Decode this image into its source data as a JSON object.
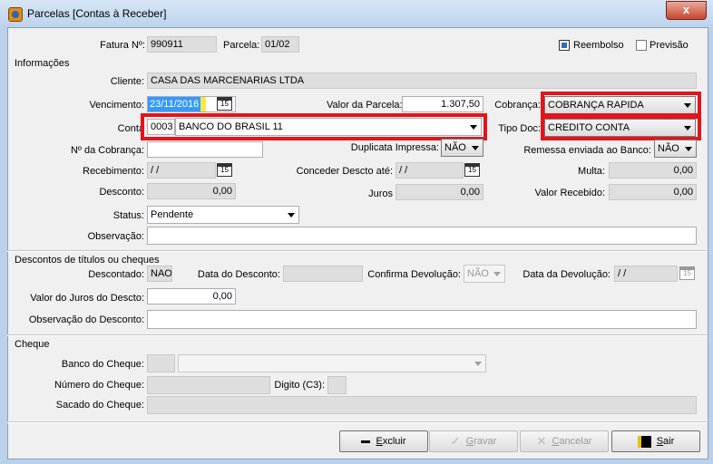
{
  "window": {
    "title": "Parcelas  [Contas à Receber]",
    "close_glyph": "x"
  },
  "header": {
    "fatura_label": "Fatura Nº:",
    "fatura_value": "990911",
    "parcela_label": "Parcela:",
    "parcela_value": "01/02",
    "reembolso_label": "Reembolso",
    "reembolso_checked": true,
    "previsao_label": "Previsão",
    "previsao_checked": false
  },
  "informacoes": {
    "section_label": "Informações",
    "cliente_label": "Cliente:",
    "cliente_value": "CASA DAS MARCENARIAS LTDA",
    "vencimento_label": "Vencimento:",
    "vencimento_value": "23/11/2016",
    "valor_parcela_label": "Valor da Parcela:",
    "valor_parcela_value": "1.307,50",
    "cobranca_label": "Cobrança:",
    "cobranca_value": "COBRANÇA RAPIDA",
    "conta_label": "Conta",
    "conta_code": "0003",
    "conta_value": "BANCO DO BRASIL 11",
    "tipo_doc_label": "Tipo Doc:",
    "tipo_doc_value": "CREDITO CONTA",
    "num_cobranca_label": "Nº da Cobrança:",
    "num_cobranca_value": "",
    "duplicata_label": "Duplicata Impressa:",
    "duplicata_value": "NÃO",
    "remessa_label": "Remessa enviada ao Banco:",
    "remessa_value": "NÃO",
    "recebimento_label": "Recebimento:",
    "recebimento_value": " / /",
    "conceder_label": "Conceder Descto até:",
    "conceder_value": " / /",
    "multa_label": "Multa:",
    "multa_value": "0,00",
    "desconto_label": "Desconto:",
    "desconto_value": "0,00",
    "juros_label": "Juros",
    "juros_value": "0,00",
    "valor_recebido_label": "Valor Recebido:",
    "valor_recebido_value": "0,00",
    "status_label": "Status:",
    "status_value": "Pendente",
    "observacao_label": "Observação:",
    "observacao_value": "",
    "calendar_glyph": "15"
  },
  "descontos": {
    "section_label": "Descontos de títulos ou cheques",
    "descontado_label": "Descontado:",
    "descontado_value": "NAO",
    "data_desconto_label": "Data do Desconto:",
    "data_desconto_value": "",
    "confirma_label": "Confirma Devolução:",
    "confirma_value": "NÃO",
    "data_devolucao_label": "Data da Devolução:",
    "data_devolucao_value": " / /",
    "valor_juros_label": "Valor do Juros  do Descto:",
    "valor_juros_value": "0,00",
    "obs_desconto_label": "Observação do Desconto:",
    "obs_desconto_value": ""
  },
  "cheque": {
    "section_label": "Cheque",
    "banco_label": "Banco do Cheque:",
    "banco_code": "",
    "banco_value": "",
    "numero_label": "Número do Cheque:",
    "numero_value": "",
    "digito_label": "Digito (C3):",
    "digito_value": "",
    "sacado_label": "Sacado do Cheque:",
    "sacado_value": ""
  },
  "buttons": {
    "excluir_prefix": "",
    "excluir_ul": "E",
    "excluir_rest": "xcluir",
    "gravar_ul": "G",
    "gravar_rest": "ravar",
    "cancelar_ul": "C",
    "cancelar_rest": "ancelar",
    "sair_ul": "S",
    "sair_rest": "air"
  },
  "colors": {
    "highlight": "#e3141b",
    "titlebar": "#bcd3ec",
    "selection": "#3399ff"
  }
}
